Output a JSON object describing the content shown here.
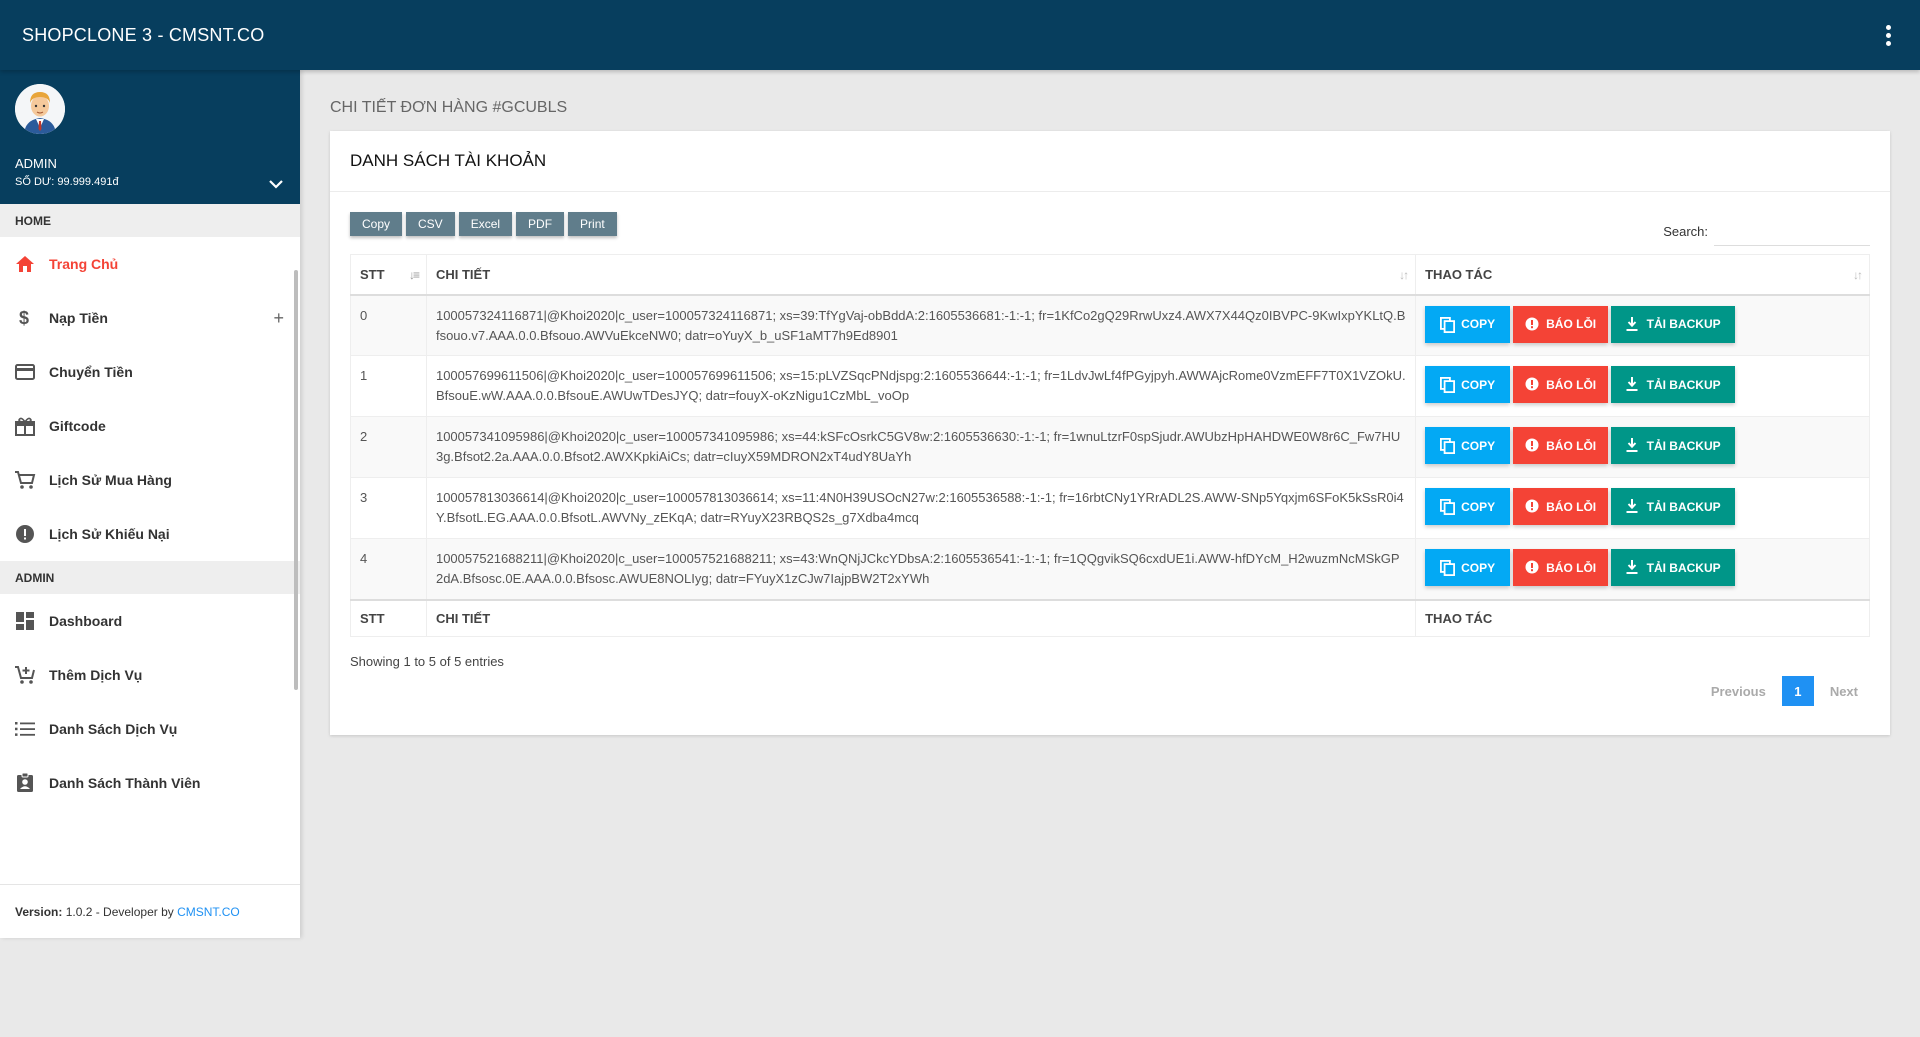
{
  "header": {
    "brand": "SHOPCLONE 3 - CMSNT.CO"
  },
  "user": {
    "name": "ADMIN",
    "balance": "SỐ DƯ: 99.999.491đ"
  },
  "menu": {
    "home_header": "HOME",
    "admin_header": "ADMIN",
    "home_items": [
      {
        "label": "Trang Chủ",
        "icon": "home-icon"
      },
      {
        "label": "Nạp Tiền",
        "icon": "dollar-icon"
      },
      {
        "label": "Chuyển Tiền",
        "icon": "credit-card-icon"
      },
      {
        "label": "Giftcode",
        "icon": "gift-icon"
      },
      {
        "label": "Lịch Sử Mua Hàng",
        "icon": "cart-icon"
      },
      {
        "label": "Lịch Sử Khiếu Nại",
        "icon": "alert-icon"
      }
    ],
    "admin_items": [
      {
        "label": "Dashboard",
        "icon": "dashboard-icon"
      },
      {
        "label": "Thêm Dịch Vụ",
        "icon": "add-cart-icon"
      },
      {
        "label": "Danh Sách Dịch Vụ",
        "icon": "list-icon"
      },
      {
        "label": "Danh Sách Thành Viên",
        "icon": "member-icon"
      }
    ]
  },
  "footer": {
    "version_label": "Version:",
    "version_text": " 1.0.2 - Developer by ",
    "developer": "CMSNT.CO"
  },
  "page": {
    "title": "CHI TIẾT ĐƠN HÀNG #GCUBLS"
  },
  "card": {
    "title": "DANH SÁCH TÀI KHOẢN"
  },
  "export_buttons": [
    "Copy",
    "CSV",
    "Excel",
    "PDF",
    "Print"
  ],
  "search": {
    "label": "Search:",
    "value": ""
  },
  "table": {
    "columns": [
      "STT",
      "CHI TIẾT",
      "THAO TÁC"
    ],
    "rows": [
      {
        "stt": "0",
        "detail": "100057324116871|@Khoi2020|c_user=100057324116871; xs=39:TfYgVaj-obBddA:2:1605536681:-1:-1; fr=1KfCo2gQ29RrwUxz4.AWX7X44Qz0IBVPC-9KwIxpYKLtQ.Bfsouo.v7.AAA.0.0.Bfsouo.AWVuEkceNW0; datr=oYuyX_b_uSF1aMT7h9Ed8901"
      },
      {
        "stt": "1",
        "detail": "100057699611506|@Khoi2020|c_user=100057699611506; xs=15:pLVZSqcPNdjspg:2:1605536644:-1:-1; fr=1LdvJwLf4fPGyjpyh.AWWAjcRome0VzmEFF7T0X1VZOkU.BfsouE.wW.AAA.0.0.BfsouE.AWUwTDesJYQ; datr=fouyX-oKzNigu1CzMbL_voOp"
      },
      {
        "stt": "2",
        "detail": "100057341095986|@Khoi2020|c_user=100057341095986; xs=44:kSFcOsrkC5GV8w:2:1605536630:-1:-1; fr=1wnuLtzrF0spSjudr.AWUbzHpHAHDWE0W8r6C_Fw7HU3g.Bfsot2.2a.AAA.0.0.Bfsot2.AWXKpkiAiCs; datr=cIuyX59MDRON2xT4udY8UaYh"
      },
      {
        "stt": "3",
        "detail": "100057813036614|@Khoi2020|c_user=100057813036614; xs=11:4N0H39USOcN27w:2:1605536588:-1:-1; fr=16rbtCNy1YRrADL2S.AWW-SNp5Yqxjm6SFoK5kSsR0i4Y.BfsotL.EG.AAA.0.0.BfsotL.AWVNy_zEKqA; datr=RYuyX23RBQS2s_g7Xdba4mcq"
      },
      {
        "stt": "4",
        "detail": "100057521688211|@Khoi2020|c_user=100057521688211; xs=43:WnQNjJCkcYDbsA:2:1605536541:-1:-1; fr=1QQgvikSQ6cxdUE1i.AWW-hfDYcM_H2wuzmNcMSkGP2dA.Bfsosc.0E.AAA.0.0.Bfsosc.AWUE8NOLIyg; datr=FYuyX1zCJw7IajpBW2T2xYWh"
      }
    ],
    "actions": {
      "copy": "COPY",
      "report": "BÁO LỖI",
      "backup": "TẢI BACKUP"
    },
    "info": "Showing 1 to 5 of 5 entries"
  },
  "pagination": {
    "previous": "Previous",
    "current": "1",
    "next": "Next"
  },
  "colors": {
    "topbar": "#073e5e",
    "copy": "#03a9f4",
    "report": "#f44336",
    "backup": "#009688",
    "active_page": "#1f91f3"
  }
}
